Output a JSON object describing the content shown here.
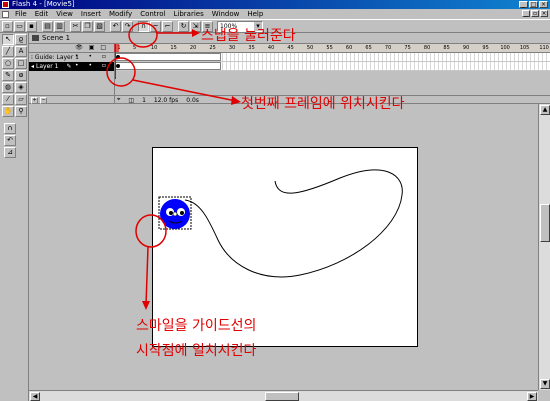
{
  "window": {
    "title": "Flash 4 - [Movie5]"
  },
  "menu": [
    "File",
    "Edit",
    "View",
    "Insert",
    "Modify",
    "Control",
    "Libraries",
    "Window",
    "Help"
  ],
  "toolbar": {
    "zoom": "100%"
  },
  "timeline": {
    "scene": "Scene 1",
    "layers": [
      {
        "name": "Guide: Layer 1",
        "selected": false
      },
      {
        "name": "Layer 1",
        "selected": true
      }
    ],
    "ruler_ticks": [
      "1",
      "5",
      "10",
      "15",
      "20",
      "25",
      "30",
      "35",
      "40",
      "45",
      "50",
      "55",
      "60",
      "65",
      "70",
      "75",
      "80",
      "85",
      "90",
      "95",
      "100",
      "105",
      "110"
    ],
    "status": {
      "frame": "1",
      "fps": "12.0 fps",
      "time": "0.0s"
    }
  },
  "annotations": {
    "snap": "스냅을 눌러준다",
    "first_frame": "첫번째 프레임에 위치시킨다",
    "guide_line1": "스마일을 가이드선의",
    "guide_line2": "시작점에 일치시킨다"
  },
  "colors": {
    "annotation": "#e00000",
    "smiley": "#0000ff",
    "titlebar": "#000080"
  }
}
